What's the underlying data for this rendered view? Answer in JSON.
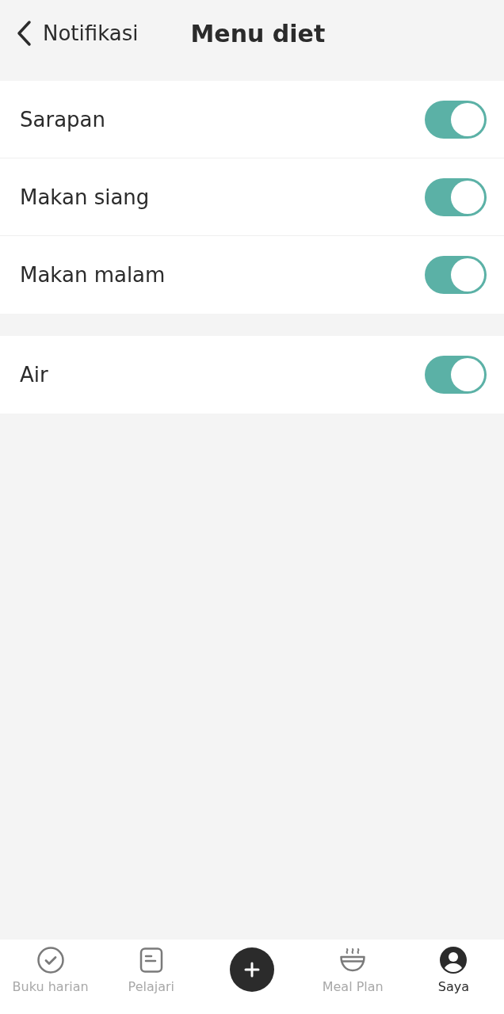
{
  "header": {
    "back_label": "Notifikasi",
    "title": "Menu diet"
  },
  "groups": [
    {
      "items": [
        {
          "label": "Sarapan",
          "on": true
        },
        {
          "label": "Makan siang",
          "on": true
        },
        {
          "label": "Makan malam",
          "on": true
        }
      ]
    },
    {
      "items": [
        {
          "label": "Air",
          "on": true
        }
      ]
    }
  ],
  "bottom_nav": [
    {
      "kind": "diary",
      "label": "Buku harian",
      "selected": false
    },
    {
      "kind": "learn",
      "label": "Pelajari",
      "selected": false
    },
    {
      "kind": "add",
      "selected": false
    },
    {
      "kind": "meal",
      "label": "Meal Plan",
      "selected": false
    },
    {
      "kind": "profile",
      "label": "Saya",
      "selected": true
    }
  ]
}
